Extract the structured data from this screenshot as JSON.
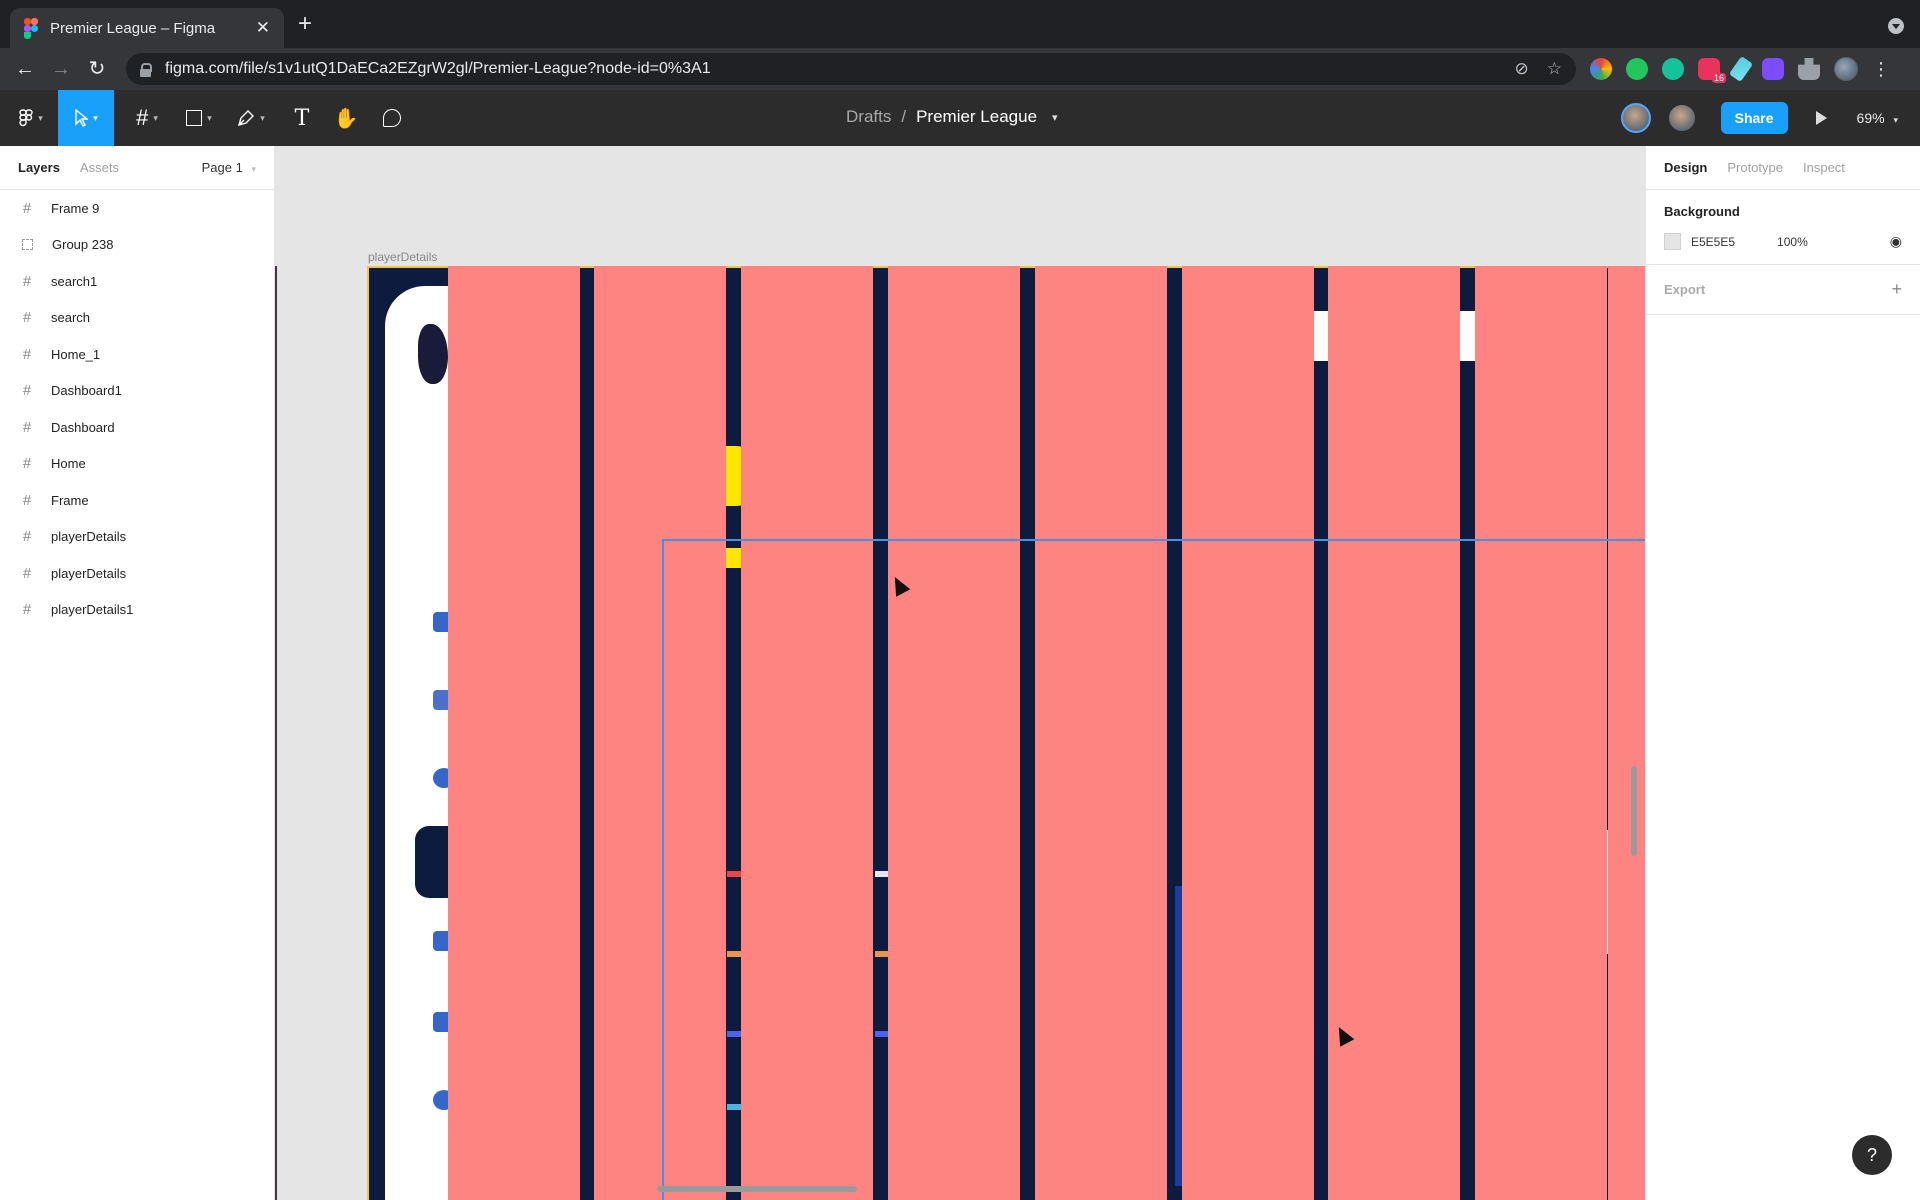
{
  "browser": {
    "tab_title": "Premier League – Figma",
    "tab_close": "✕",
    "new_tab": "+",
    "url": "figma.com/file/s1v1utQ1DaECa2EZgrW2gl/Premier-League?node-id=0%3A1",
    "back": "←",
    "forward": "→",
    "reload": "↻",
    "ext_badge": "16",
    "kebab": "⋮"
  },
  "figma": {
    "breadcrumb_parent": "Drafts",
    "breadcrumb_sep": "/",
    "file_name": "Premier League",
    "share_label": "Share",
    "zoom": "69%",
    "accent": "#18a0fb"
  },
  "left_panel": {
    "tab_layers": "Layers",
    "tab_assets": "Assets",
    "page": "Page 1",
    "layers": [
      {
        "name": "Frame 9",
        "type": "frame"
      },
      {
        "name": "Group 238",
        "type": "group"
      },
      {
        "name": "search1",
        "type": "frame"
      },
      {
        "name": "search",
        "type": "frame"
      },
      {
        "name": "Home_1",
        "type": "frame"
      },
      {
        "name": "Dashboard1",
        "type": "frame"
      },
      {
        "name": "Dashboard",
        "type": "frame"
      },
      {
        "name": "Home",
        "type": "frame"
      },
      {
        "name": "Frame",
        "type": "frame"
      },
      {
        "name": "playerDetails",
        "type": "frame"
      },
      {
        "name": "playerDetails",
        "type": "frame"
      },
      {
        "name": "playerDetails1",
        "type": "frame"
      }
    ]
  },
  "canvas": {
    "frame_label": "playerDetails",
    "stripe_color": "#fe8482",
    "frame_color": "#0d1b3e"
  },
  "right_panel": {
    "tab_design": "Design",
    "tab_prototype": "Prototype",
    "tab_inspect": "Inspect",
    "background_title": "Background",
    "background_hex": "E5E5E5",
    "background_opacity": "100%",
    "export_title": "Export"
  },
  "help": "?"
}
